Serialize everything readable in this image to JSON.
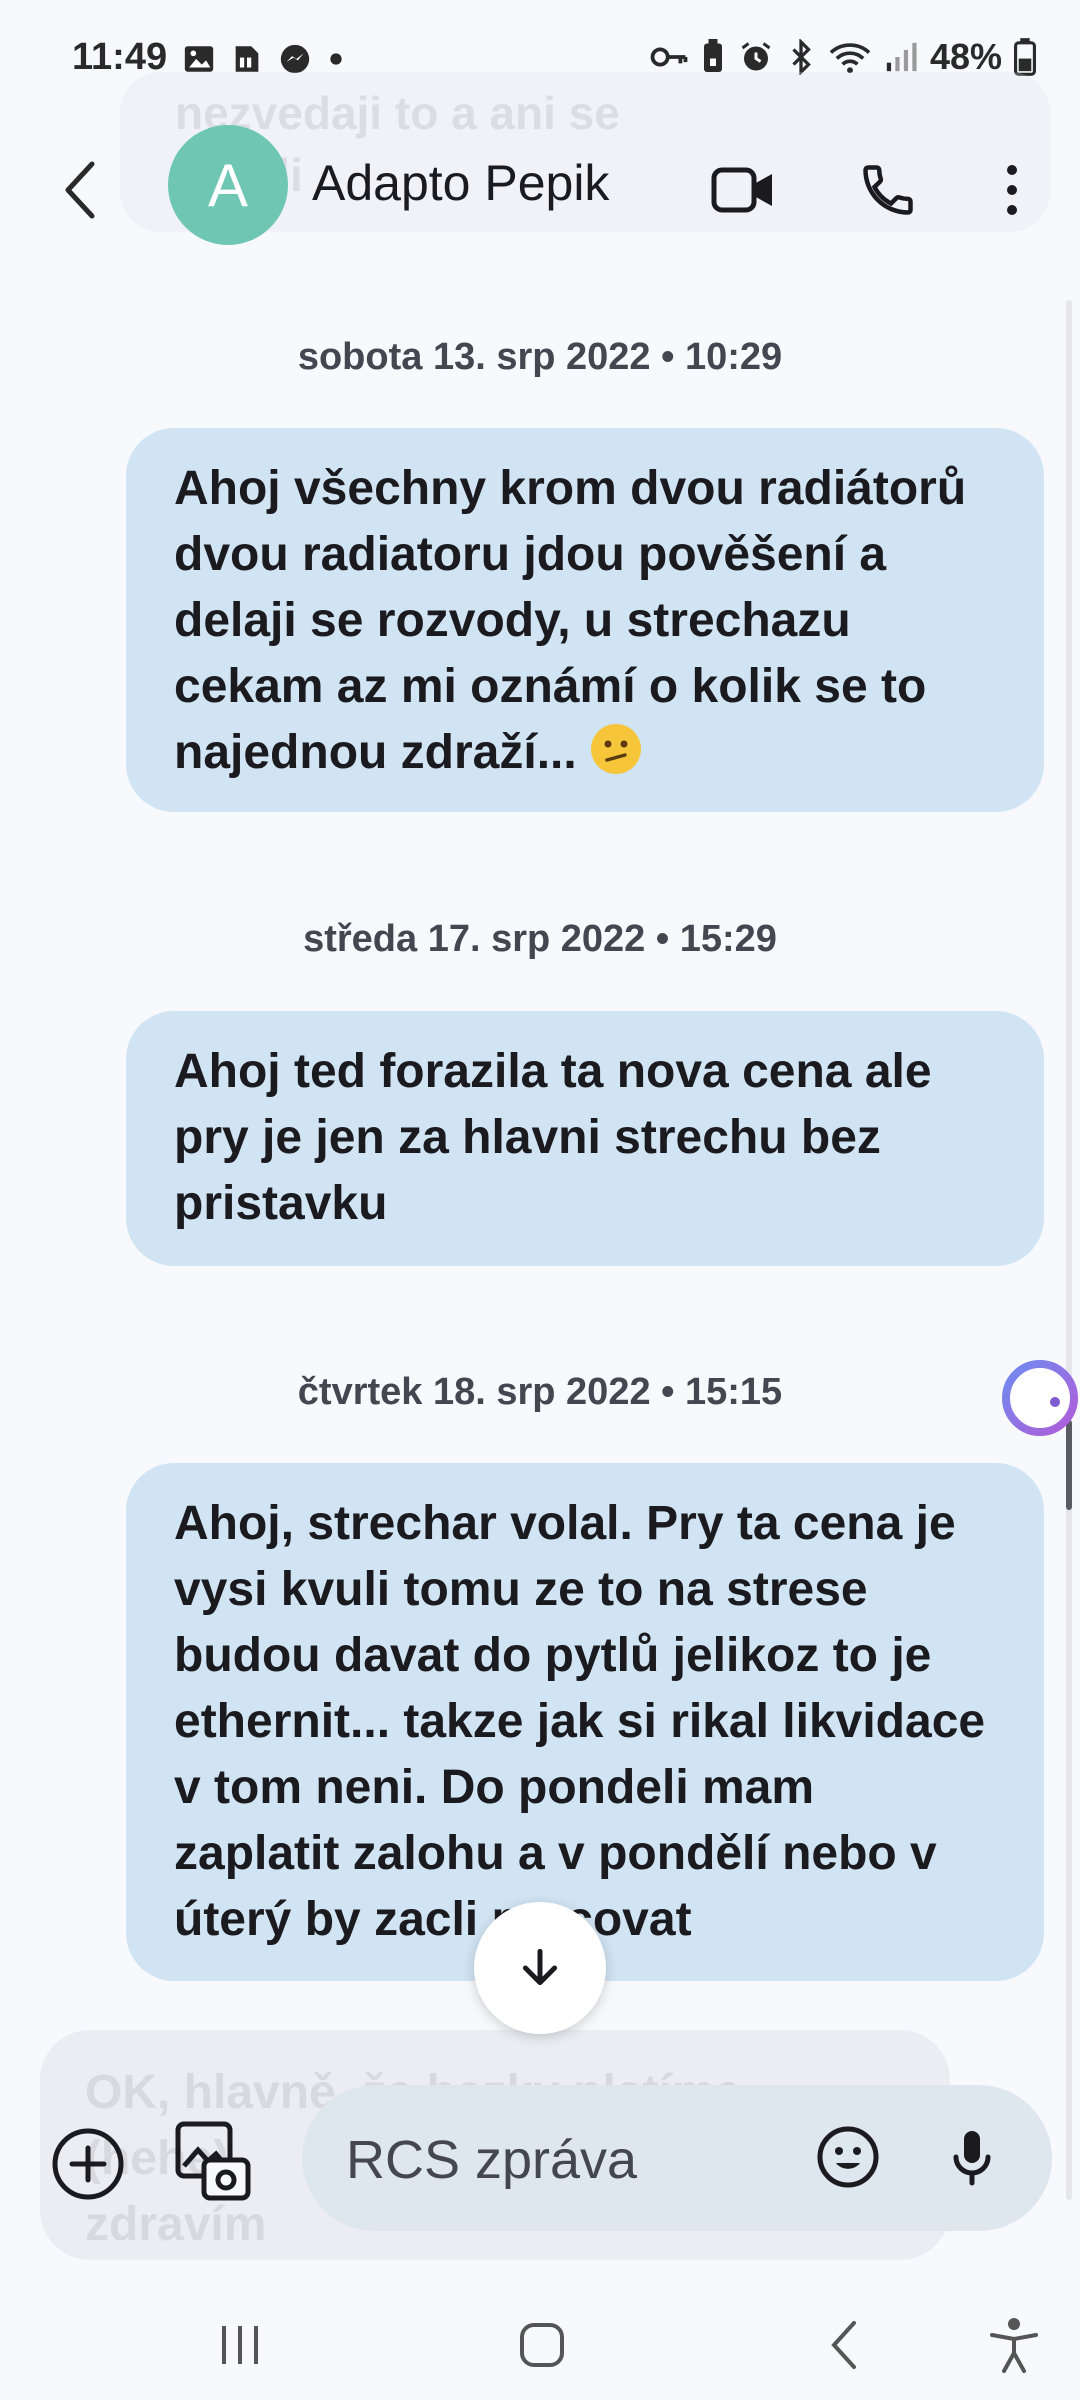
{
  "status_bar": {
    "time": "11:49",
    "battery": "48%",
    "left_icons": [
      "gallery-icon",
      "sim-icon",
      "messenger-icon",
      "dot-icon"
    ],
    "right_icons": [
      "key-icon",
      "battery-saver-icon",
      "alarm-icon",
      "bluetooth-icon",
      "wifi-icon",
      "signal-icon",
      "battery-icon"
    ]
  },
  "header": {
    "avatar_letter": "A",
    "contact_name": "Adapto Pepik",
    "ghost_text": "nezvedaji to a ani se\nozvali"
  },
  "messages": [
    {
      "date": "sobota 13. srp 2022 • 10:29",
      "text": "Ahoj všechny krom dvou radiátorů dvou radiatoru jdou pověšení a delaji se rozvody, u strechazu cekam az mi oznámí o kolik se to najednou zdraží...",
      "emoji": "confused-face"
    },
    {
      "date": "středa 17. srp 2022 • 15:29",
      "text": "Ahoj ted forazila ta nova cena ale pry je jen za hlavni strechu bez pristavku"
    },
    {
      "date": "čtvrtek 18. srp 2022 • 15:15",
      "text": "Ahoj, strechar volal. Pry ta cena je vysi kvuli tomu ze to na strese budou davat do pytlů jelikoz to je ethernit... takze jak si rikal likvidace v tom neni. Do pondeli mam zaplatit zalohu a v pondělí nebo v úterý by zacli pracovat"
    }
  ],
  "ghost_bottom_text": "OK, hlavně, že hezky platíme\n(hehe)\nzdravím",
  "input": {
    "placeholder": "RCS zpráva"
  },
  "colors": {
    "background": "#f8f9fd",
    "bubble": "#d1e4f3",
    "avatar": "#6fc6b3",
    "input_field": "#dfe7ee"
  }
}
